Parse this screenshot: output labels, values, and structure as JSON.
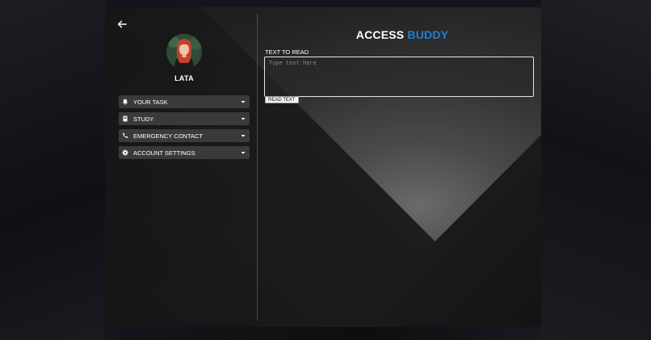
{
  "app": {
    "title_part1": "ACCESS",
    "title_part2": "BUDDY",
    "accent_color": "#1e7fd6"
  },
  "sidebar": {
    "back_icon": "arrow-left-icon",
    "user": {
      "name": "LATA",
      "avatar_icon": "user-avatar"
    },
    "menu": [
      {
        "label": "YOUR TASK",
        "icon": "bell-icon"
      },
      {
        "label": "STUDY",
        "icon": "book-icon"
      },
      {
        "label": "EMERGENCY CONTACT",
        "icon": "phone-icon"
      },
      {
        "label": "ACCOUNT SETTINGS",
        "icon": "gear-icon"
      }
    ],
    "caret_icon": "caret-down-icon"
  },
  "main": {
    "field_label": "TEXT TO READ",
    "textarea_placeholder": "Type text here",
    "textarea_value": "",
    "read_button_label": "READ TEXT"
  }
}
